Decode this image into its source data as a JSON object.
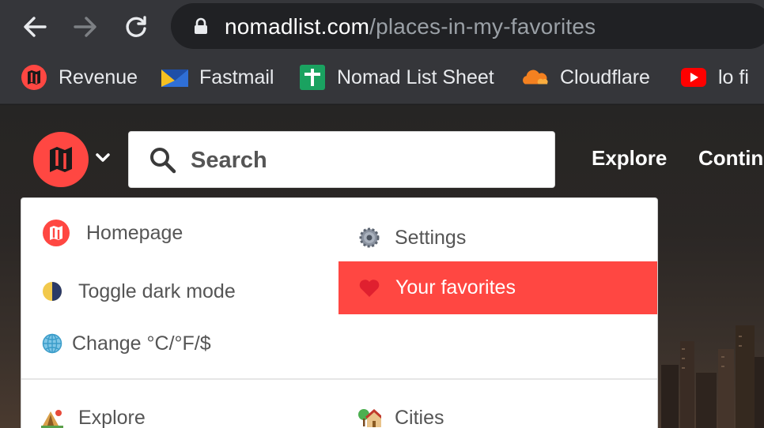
{
  "browser": {
    "url_host": "nomadlist.com",
    "url_path": "/places-in-my-favorites",
    "bookmarks": [
      {
        "label": "Revenue",
        "icon": "nomadlist-logo-icon"
      },
      {
        "label": "Fastmail",
        "icon": "fastmail-icon"
      },
      {
        "label": "Nomad List Sheet",
        "icon": "google-sheets-icon"
      },
      {
        "label": "Cloudflare",
        "icon": "cloudflare-icon"
      },
      {
        "label": "lo fi",
        "icon": "youtube-icon"
      }
    ]
  },
  "site": {
    "search_placeholder": "Search",
    "nav": [
      "Explore",
      "Contin"
    ],
    "accent_color": "#ff4742",
    "menu": {
      "homepage": "Homepage",
      "settings": "Settings",
      "dark_mode": "Toggle dark mode",
      "favorites": "Your favorites",
      "units": "Change °C/°F/$",
      "explore": "Explore",
      "cities": "Cities"
    }
  }
}
